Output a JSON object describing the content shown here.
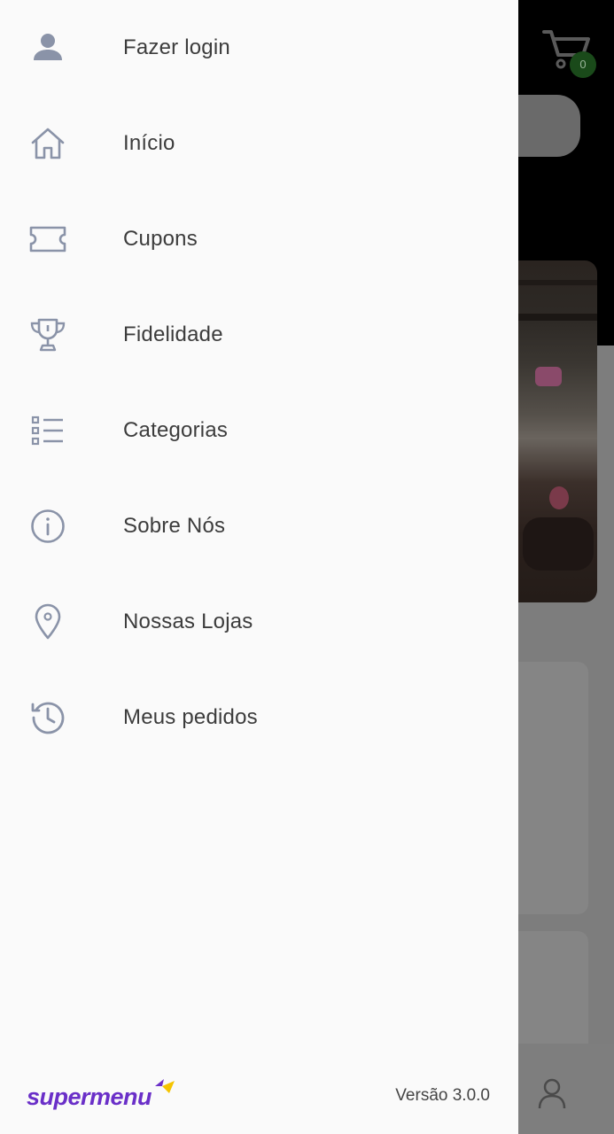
{
  "drawer": {
    "items": [
      {
        "label": "Fazer login",
        "icon": "user-icon"
      },
      {
        "label": "Início",
        "icon": "home-icon"
      },
      {
        "label": "Cupons",
        "icon": "ticket-icon"
      },
      {
        "label": "Fidelidade",
        "icon": "trophy-icon"
      },
      {
        "label": "Categorias",
        "icon": "list-icon"
      },
      {
        "label": "Sobre Nós",
        "icon": "info-icon"
      },
      {
        "label": "Nossas Lojas",
        "icon": "location-pin-icon"
      },
      {
        "label": "Meus pedidos",
        "icon": "history-icon"
      }
    ],
    "footer": {
      "brand": "supermenu",
      "version": "Versão 3.0.0"
    }
  },
  "background": {
    "cart_count": "0"
  },
  "colors": {
    "drawer_bg": "#fafafa",
    "icon": "#8a93a8",
    "text": "#3c3c3c",
    "brand": "#6a2fc8",
    "brand_accent": "#f5c400",
    "cart_badge": "#1a4a1a"
  }
}
